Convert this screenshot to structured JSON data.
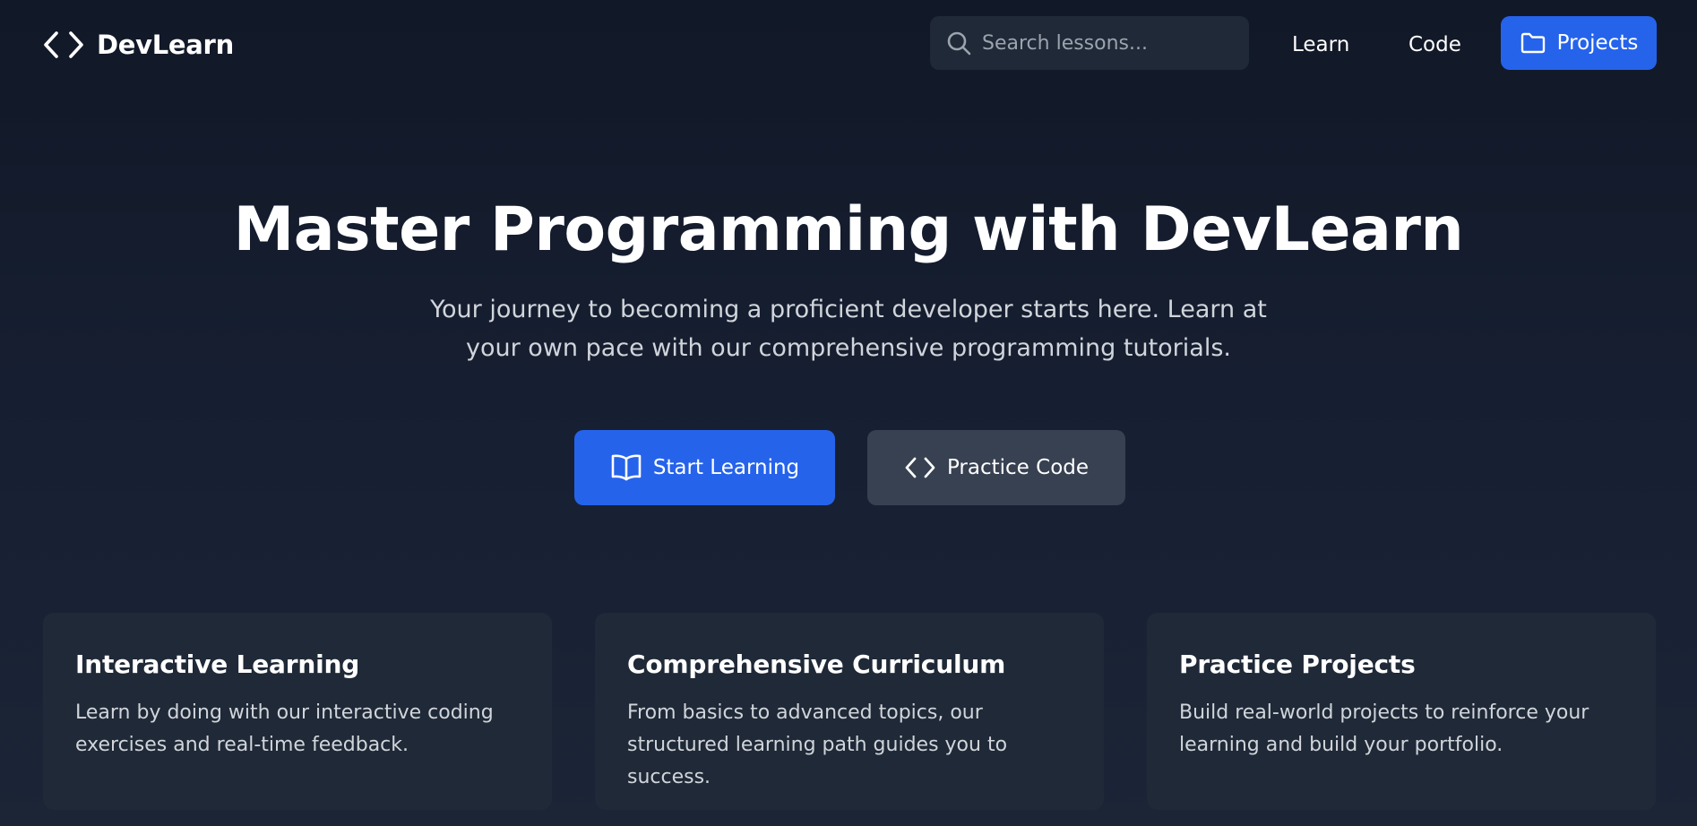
{
  "header": {
    "brand_name": "DevLearn",
    "search": {
      "placeholder": "Search lessons...",
      "value": ""
    },
    "nav": {
      "learn_label": "Learn",
      "code_label": "Code",
      "projects_label": "Projects"
    }
  },
  "hero": {
    "title": "Master Programming with DevLearn",
    "subtitle": "Your journey to becoming a proficient developer starts here. Learn at your own pace with our comprehensive programming tutorials.",
    "primary_button": {
      "label": "Start Learning",
      "icon": "book-open-icon"
    },
    "secondary_button": {
      "label": "Practice Code",
      "icon": "code-icon"
    }
  },
  "features": [
    {
      "title": "Interactive Learning",
      "description": "Learn by doing with our interactive coding exercises and real-time feedback."
    },
    {
      "title": "Comprehensive Curriculum",
      "description": "From basics to advanced topics, our structured learning path guides you to success."
    },
    {
      "title": "Practice Projects",
      "description": "Build real-world projects to reinforce your learning and build your portfolio."
    }
  ],
  "colors": {
    "background": "#111827",
    "surface": "#1f2937",
    "primary": "#2563eb",
    "secondary": "#374151",
    "text": "#ffffff",
    "muted_text": "#d1d5db",
    "placeholder_text": "#9ca3af"
  },
  "icons": {
    "brand": "code-icon",
    "search": "search-icon",
    "projects": "folder-icon"
  }
}
